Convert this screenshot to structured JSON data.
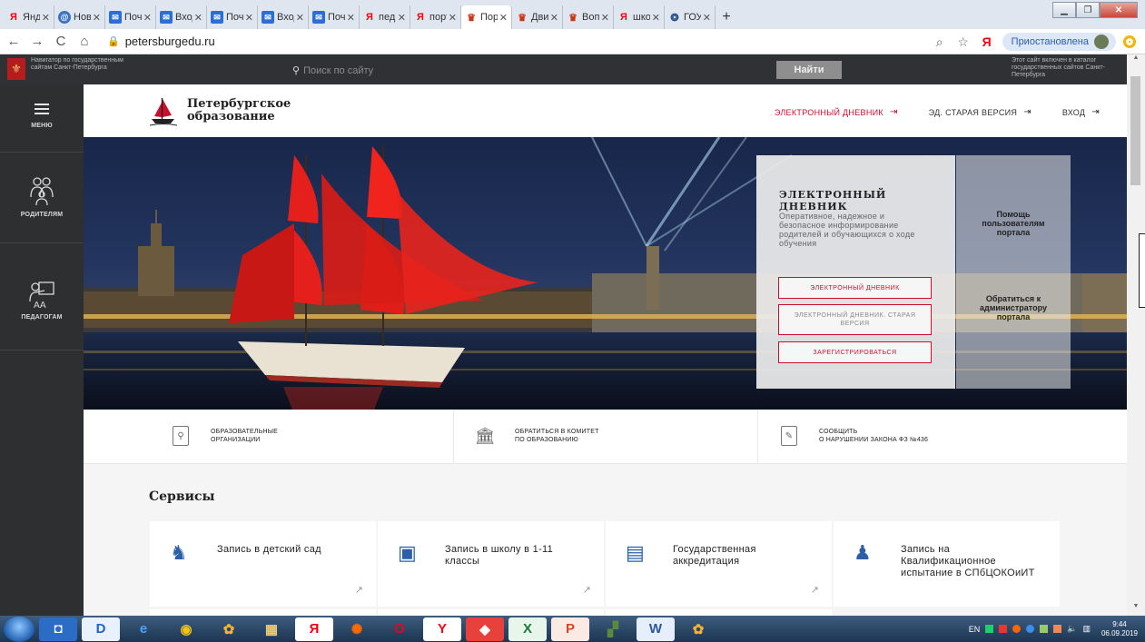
{
  "browser": {
    "tabs": [
      {
        "label": "Яндекс",
        "icon": "yandex-icon",
        "active": false
      },
      {
        "label": "Новос",
        "icon": "news-icon",
        "active": false
      },
      {
        "label": "Почта",
        "icon": "mail-icon",
        "active": false
      },
      {
        "label": "Входя",
        "icon": "mail-icon",
        "active": false
      },
      {
        "label": "Почта",
        "icon": "mail-icon",
        "active": false
      },
      {
        "label": "Входя",
        "icon": "mail-icon",
        "active": false
      },
      {
        "label": "Почта",
        "icon": "mail-icon",
        "active": false
      },
      {
        "label": "пед ин",
        "icon": "yandex-icon",
        "active": false
      },
      {
        "label": "портал",
        "icon": "yandex-icon",
        "active": false
      },
      {
        "label": "Порта",
        "icon": "spb-icon",
        "active": true
      },
      {
        "label": "Движе",
        "icon": "spb-icon",
        "active": false
      },
      {
        "label": "Вопро",
        "icon": "spb-icon",
        "active": false
      },
      {
        "label": "школа",
        "icon": "yandex-icon",
        "active": false
      },
      {
        "label": "ГОУ С",
        "icon": "gou-icon",
        "active": false
      }
    ],
    "new_tab": "+",
    "url": "petersburgedu.ru",
    "sync_status": "Приостановлена",
    "yandex_glyph": "Я"
  },
  "gov_strip": {
    "left_text": "Навигатор по государственным сайтам Санкт-Петербурга",
    "search_placeholder": "Поиск по сайту",
    "search_button": "Найти",
    "right_text": "Этот сайт включен в каталог государственных сайтов Санкт-Петербурга"
  },
  "sidebar": {
    "menu_label": "МЕНЮ",
    "parents_label": "РОДИТЕЛЯМ",
    "teachers_label": "ПЕДАГОГАМ"
  },
  "header": {
    "brand_line1": "Петербургское",
    "brand_line2": "образование",
    "links": [
      "ЭЛЕКТРОННЫЙ ДНЕВНИК",
      "ЭД. СТАРАЯ ВЕРСИЯ",
      "ВХОД"
    ]
  },
  "diary_card": {
    "title": "ЭЛЕКТРОННЫЙ ДНЕВНИК",
    "description": "Оперативное, надежное и безопасное информирование родителей и обучающихся о ходе обучения",
    "btn_diary": "ЭЛЕКТРОННЫЙ ДНЕВНИК",
    "btn_old_line1": "ЭЛЕКТРОННЫЙ ДНЕВНИК. СТАРАЯ",
    "btn_old_line2": "ВЕРСИЯ",
    "btn_register": "ЗАРЕГИСТРИРОВАТЬСЯ"
  },
  "help_card": {
    "help_line1": "Помощь",
    "help_line2": "пользователям",
    "help_line3": "портала",
    "admin_line1": "Обратиться к",
    "admin_line2": "администратору",
    "admin_line3": "портала"
  },
  "quick_links": [
    {
      "line1": "ОБРАЗОВАТЕЛЬНЫЕ",
      "line2": "ОРГАНИЗАЦИИ"
    },
    {
      "line1": "ОБРАТИТЬСЯ В КОМИТЕТ",
      "line2": "ПО ОБРАЗОВАНИЮ"
    },
    {
      "line1": "СООБЩИТЬ",
      "line2": "О НАРУШЕНИИ ЗАКОНА ФЗ №436"
    }
  ],
  "services": {
    "title": "Сервисы",
    "cards": [
      {
        "label": "Запись в детский сад"
      },
      {
        "label": "Запись в школу в 1-11 классы"
      },
      {
        "label": "Государственная аккредитация"
      },
      {
        "label": "Запись на Квалификационное испытание в СПбЦОКОиИТ"
      }
    ]
  },
  "taskbar": {
    "lang": "EN",
    "time": "9:44",
    "date": "06.09.2019",
    "yandex_glyph": "Я"
  },
  "colors": {
    "accent_red": "#c8102e",
    "sidebar_bg": "#2d2f31",
    "gov_bar_bg": "#2f3134"
  }
}
